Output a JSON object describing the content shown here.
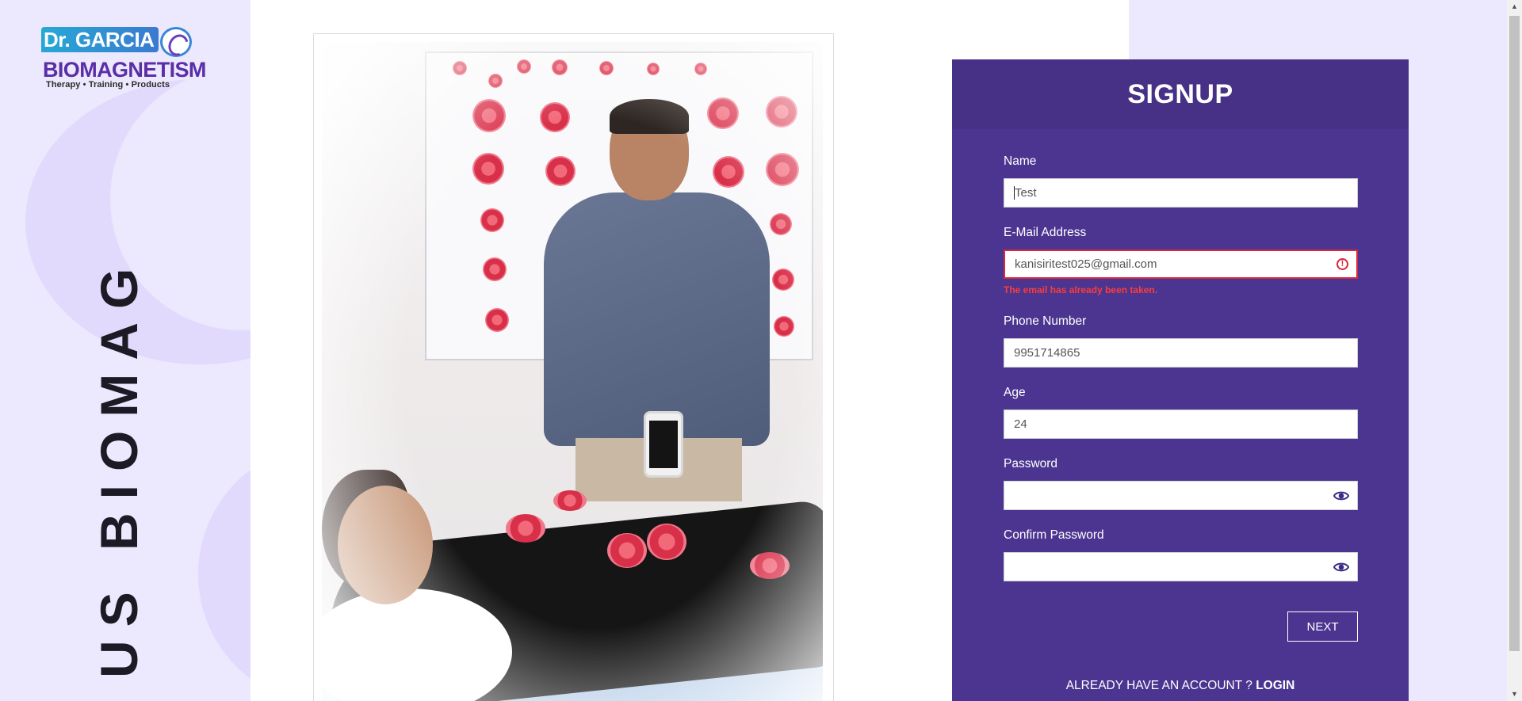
{
  "brand": {
    "logo_line1": "Dr. GARCIA",
    "logo_line2": "BIOMAGNETISM",
    "logo_tagline": "Therapy • Training • Products",
    "vertical_title": "US BIOMAG"
  },
  "photo": {
    "icon": "therapy-photo"
  },
  "signup": {
    "title": "SIGNUP",
    "fields": {
      "name": {
        "label": "Name",
        "value": "Test"
      },
      "email": {
        "label": "E-Mail Address",
        "value": "kanisiritest025@gmail.com",
        "error": "The email has already been taken."
      },
      "phone": {
        "label": "Phone Number",
        "value": "9951714865"
      },
      "age": {
        "label": "Age",
        "value": "24"
      },
      "password": {
        "label": "Password",
        "value": ""
      },
      "confirm_password": {
        "label": "Confirm Password",
        "value": ""
      }
    },
    "next_label": "NEXT",
    "account_prompt": "ALREADY HAVE AN ACCOUNT ?",
    "login_label": "LOGIN"
  },
  "colors": {
    "card": "#4b3590",
    "sidebar": "#ece8fd",
    "error": "#d7263d"
  }
}
